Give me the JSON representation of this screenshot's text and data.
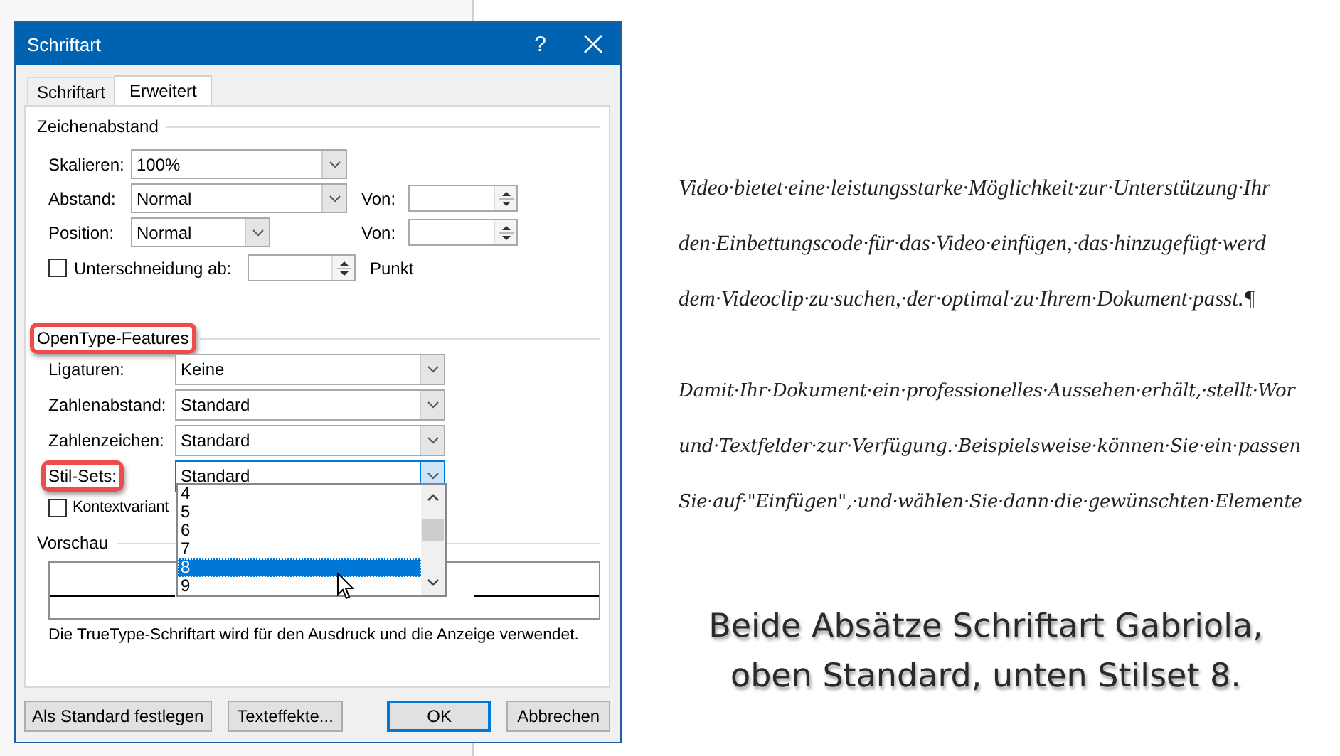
{
  "window": {
    "title": "Schriftart",
    "help": "?"
  },
  "tabs": [
    {
      "label": "Schriftart",
      "selected": false
    },
    {
      "label": "Erweitert",
      "selected": true
    }
  ],
  "spacing": {
    "heading": "Zeichenabstand",
    "rows": [
      {
        "label": "Skalieren:",
        "value": "100%"
      },
      {
        "label": "Abstand:",
        "value": "Normal",
        "spin_label": "Von:"
      },
      {
        "label": "Position:",
        "value": "Normal",
        "spin_label": "Von:"
      }
    ],
    "kerning": {
      "label": "Unterschneidung ab:",
      "checked": false,
      "unit": "Punkt"
    }
  },
  "opentype": {
    "heading": "OpenType-Features",
    "highlighted": true,
    "rows": [
      {
        "label": "Ligaturen:",
        "value": "Keine",
        "highlighted": false,
        "open": false
      },
      {
        "label": "Zahlenabstand:",
        "value": "Standard",
        "highlighted": false,
        "open": false
      },
      {
        "label": "Zahlenzeichen:",
        "value": "Standard",
        "highlighted": false,
        "open": false
      },
      {
        "label": "Stil-Sets:",
        "value": "Standard",
        "highlighted": true,
        "open": true
      }
    ],
    "context": {
      "label": "Kontextvariant",
      "checked": false
    }
  },
  "dropdown": {
    "items": [
      {
        "label": "4",
        "selected": false
      },
      {
        "label": "5",
        "selected": false
      },
      {
        "label": "6",
        "selected": false
      },
      {
        "label": "7",
        "selected": false
      },
      {
        "label": "8",
        "selected": true
      },
      {
        "label": "9",
        "selected": false
      }
    ]
  },
  "preview": {
    "heading": "Vorschau",
    "note": "Die TrueType-Schriftart wird für den Ausdruck und die Anzeige verwendet."
  },
  "buttons": [
    {
      "label": "Als Standard festlegen",
      "default": false
    },
    {
      "label": "Texteffekte...",
      "default": false
    },
    {
      "label": "OK",
      "default": true
    },
    {
      "label": "Abbrechen",
      "default": false
    }
  ],
  "document": {
    "paragraphs": [
      {
        "kind": "standard",
        "lines": [
          "Video·bietet·eine·leistungsstarke·Möglichkeit·zur·Unterstützung·Ihr",
          "den·Einbettungscode·für·das·Video·einfügen,·das·hinzugefügt·werd",
          "dem·Videoclip·zu·suchen,·der·optimal·zu·Ihrem·Dokument·passt.¶"
        ]
      },
      {
        "kind": "stilset",
        "lines": [
          "Damit·Ihr·Dokument·ein·professionelles·Aussehen·erhält,·stellt·Wor",
          "und·Textfelder·zur·Verfügung.·Beispielsweise·können·Sie·ein·passen",
          "Sie·auf·\"Einfügen\",·und·wählen·Sie·dann·die·gewünschten·Elemente"
        ]
      }
    ]
  },
  "caption": {
    "lines": [
      "Beide Absätze Schriftart Gabriola,",
      "oben Standard, unten Stilset 8."
    ]
  }
}
